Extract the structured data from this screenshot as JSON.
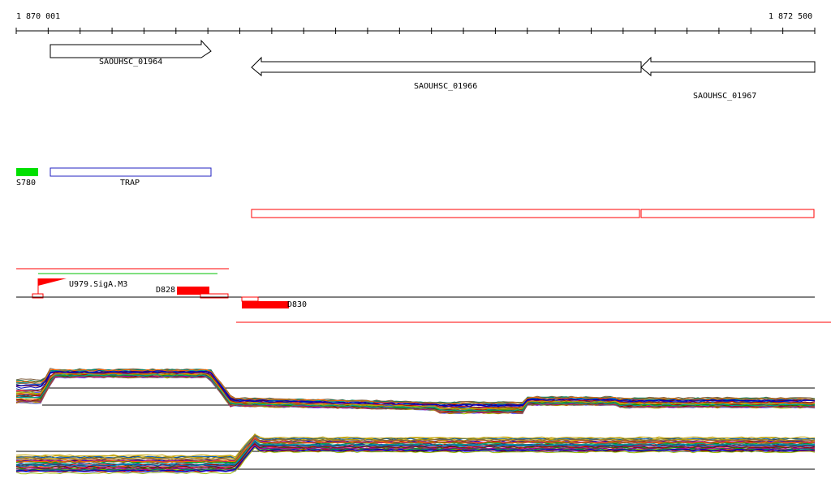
{
  "ruler": {
    "start_label": "1 870 001",
    "end_label": "1 872 500"
  },
  "genes": [
    {
      "id": "gene-saouhsc-01964",
      "label": "SAOUHSC_01964",
      "strand": "+"
    },
    {
      "id": "gene-saouhsc-01966",
      "label": "SAOUHSC_01966",
      "strand": "-"
    },
    {
      "id": "gene-saouhsc-01967",
      "label": "SAOUHSC_01967",
      "strand": "-"
    }
  ],
  "features": {
    "s780_label": "S780",
    "trap_label": "TRAP"
  },
  "elements": {
    "promoter_label": "U979.SigA.M3",
    "d828_label": "D828",
    "d830_label": "D830"
  },
  "colors": {
    "gene_stroke": "#000000",
    "s780_fill": "#00e000",
    "trap_stroke": "#2020c0",
    "red": "#ff0000",
    "red_light": "#ff8080",
    "green_line": "#00c000",
    "tiling_palette": [
      "#c00000",
      "#00a000",
      "#0000c0",
      "#c0a000",
      "#a000a0",
      "#00a0a0",
      "#ff6600",
      "#806040",
      "#008060",
      "#6060ff",
      "#ff60a0",
      "#404040",
      "#a0c000",
      "#c06000",
      "#0060c0",
      "#800000"
    ]
  }
}
